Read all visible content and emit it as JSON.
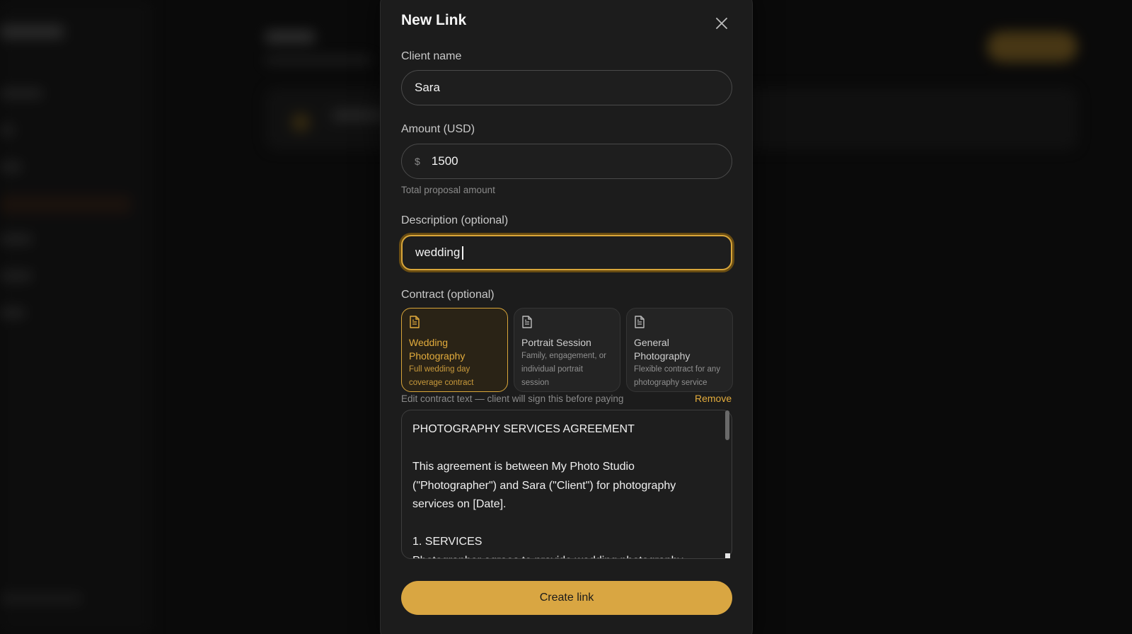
{
  "modal": {
    "title": "New Link",
    "client_name": {
      "label": "Client name",
      "value": "Sara"
    },
    "amount": {
      "label": "Amount (USD)",
      "currency_symbol": "$",
      "value": "1500",
      "hint": "Total proposal amount"
    },
    "description": {
      "label": "Description (optional)",
      "value": "wedding"
    },
    "contract": {
      "label": "Contract (optional)",
      "options": [
        {
          "title": "Wedding Photography",
          "description": "Full wedding day coverage contract",
          "selected": true
        },
        {
          "title": "Portrait Session",
          "description": "Family, engagement, or individual portrait session",
          "selected": false
        },
        {
          "title": "General Photography",
          "description": "Flexible contract for any photography service",
          "selected": false
        }
      ],
      "edit_hint": "Edit contract text — client will sign this before paying",
      "remove_label": "Remove",
      "text": "PHOTOGRAPHY SERVICES AGREEMENT\n\nThis agreement is between My Photo Studio (\"Photographer\") and Sara (\"Client\") for photography services on [Date].\n\n1. SERVICES\nPhotographer agrees to provide wedding photography"
    },
    "submit_label": "Create link"
  },
  "colors": {
    "accent": "#d9a642",
    "modal_bg": "#1c1c1c",
    "page_bg": "#0a0a0a"
  },
  "icons": {
    "close": "close-icon",
    "document": "document-icon"
  }
}
